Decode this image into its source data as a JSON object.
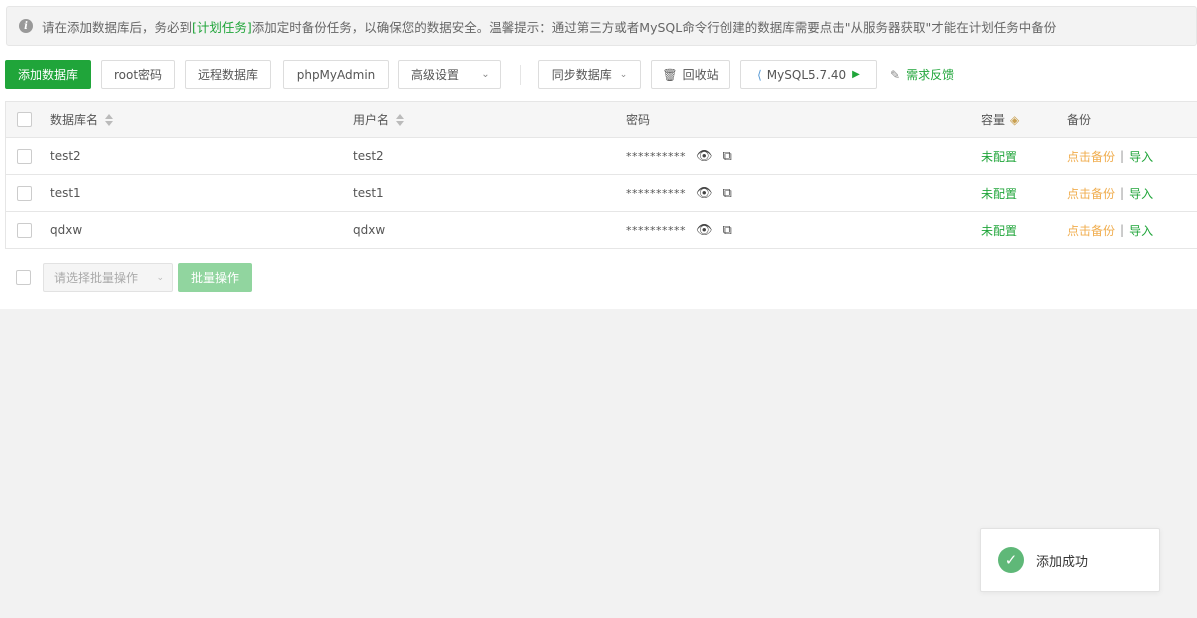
{
  "notice": {
    "text_before": "请在添加数据库后，务必到",
    "link": "[计划任务]",
    "text_after": "添加定时备份任务，以确保您的数据安全。温馨提示：通过第三方或者MySQL命令行创建的数据库需要点击\"从服务器获取\"才能在计划任务中备份"
  },
  "toolbar": {
    "add_db": "添加数据库",
    "root_pw": "root密码",
    "remote_db": "远程数据库",
    "phpmyadmin": "phpMyAdmin",
    "advanced": "高级设置",
    "sync_db": "同步数据库",
    "recycle": "回收站",
    "mysql_version": "MySQL5.7.40",
    "feedback": "需求反馈"
  },
  "table": {
    "headers": {
      "name": "数据库名",
      "user": "用户名",
      "password": "密码",
      "capacity": "容量",
      "backup": "备份"
    },
    "rows": [
      {
        "name": "test2",
        "user": "test2",
        "password": "**********",
        "capacity": "未配置",
        "backup": "点击备份",
        "import": "导入"
      },
      {
        "name": "test1",
        "user": "test1",
        "password": "**********",
        "capacity": "未配置",
        "backup": "点击备份",
        "import": "导入"
      },
      {
        "name": "qdxw",
        "user": "qdxw",
        "password": "**********",
        "capacity": "未配置",
        "backup": "点击备份",
        "import": "导入"
      }
    ],
    "separator": "|"
  },
  "batch": {
    "select_placeholder": "请选择批量操作",
    "button": "批量操作"
  },
  "toast": {
    "message": "添加成功"
  },
  "colors": {
    "primary": "#20a53a",
    "warning": "#f0ad4e",
    "success_icon": "#5fb878"
  },
  "icons": {
    "info": "info-icon",
    "eye": "eye-icon",
    "copy": "copy-icon",
    "trash": "trash-icon",
    "leaf": "mysql-leaf-icon",
    "play": "play-icon",
    "edit": "edit-icon",
    "gem": "gem-icon",
    "check": "check-icon"
  }
}
